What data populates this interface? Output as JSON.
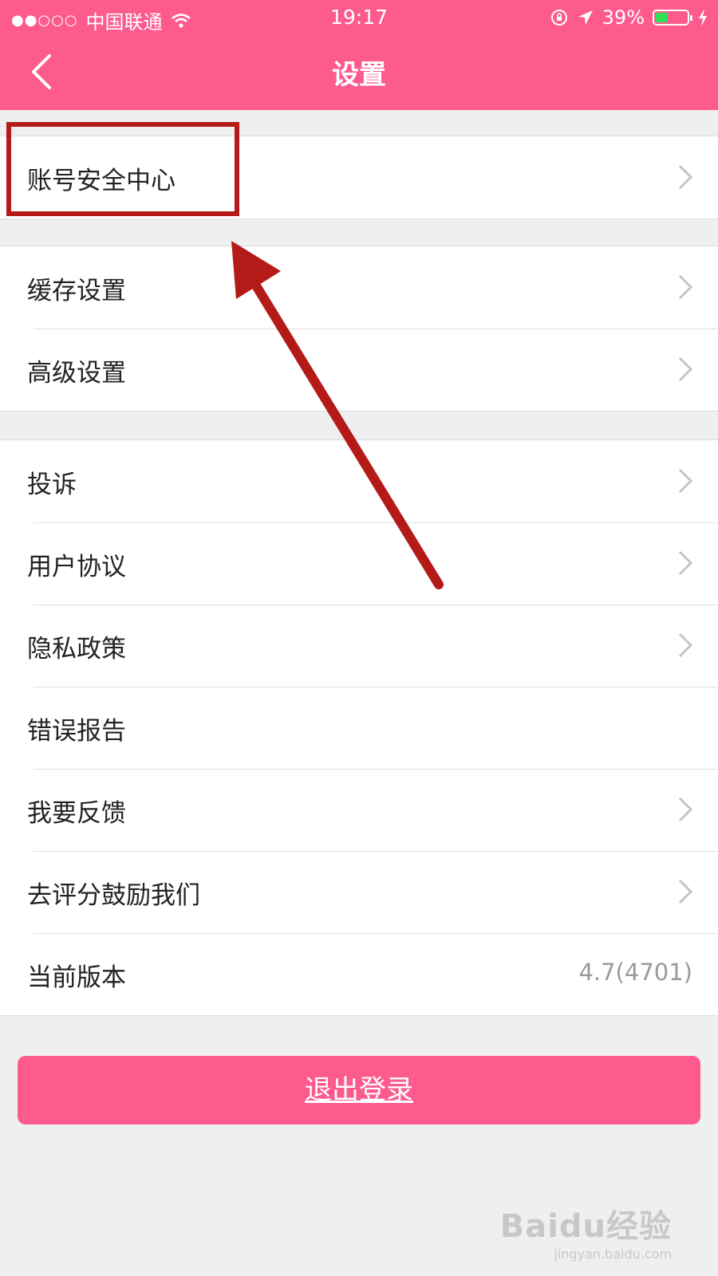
{
  "status_bar": {
    "signal": "●●○○○",
    "carrier": "中国联通",
    "time": "19:17",
    "battery_text": "39%",
    "battery_level": 0.39
  },
  "header": {
    "title": "设置"
  },
  "groups": [
    {
      "items": [
        {
          "label": "账号安全中心",
          "chevron": true
        }
      ]
    },
    {
      "items": [
        {
          "label": "缓存设置",
          "chevron": true
        },
        {
          "label": "高级设置",
          "chevron": true
        }
      ]
    },
    {
      "items": [
        {
          "label": "投诉",
          "chevron": true
        },
        {
          "label": "用户协议",
          "chevron": true
        },
        {
          "label": "隐私政策",
          "chevron": true
        },
        {
          "label": "错误报告",
          "chevron": false
        },
        {
          "label": "我要反馈",
          "chevron": true
        },
        {
          "label": "去评分鼓励我们",
          "chevron": true
        },
        {
          "label": "当前版本",
          "chevron": false,
          "value": "4.7(4701)"
        }
      ]
    }
  ],
  "logout_label": "退出登录",
  "watermark": {
    "logo": "Baidu经验",
    "url": "jingyan.baidu.com"
  },
  "colors": {
    "accent": "#fd5a8e",
    "annotation": "#b41a17",
    "background": "#efeff0"
  }
}
